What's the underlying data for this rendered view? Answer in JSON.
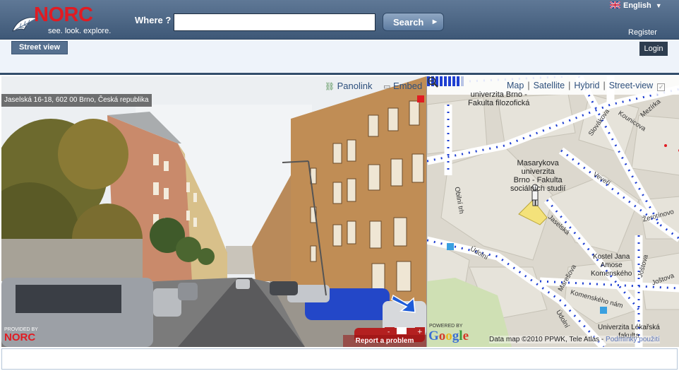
{
  "header": {
    "logo_word": "NORC",
    "slogan": "see. look. explore.",
    "where_label": "Where ?",
    "where_value": "",
    "search_label": "Search",
    "language": "English",
    "register_label": "Register"
  },
  "subbar": {
    "street_view_tab": "Street view",
    "login_label": "Login"
  },
  "panorama": {
    "panolink_label": "Panolink",
    "embed_label": "Embed",
    "address": "Jaselská 16-18, 602 00 Brno, Česká republika",
    "report_label": "Report a problem",
    "provided_by": "PROVIDED BY",
    "provided_logo": "NORC"
  },
  "map": {
    "types": [
      "Map",
      "Satellite",
      "Hybrid",
      "Street-view"
    ],
    "labels": {
      "fil_fac": "univerzita Brno -\nFakulta filozofická",
      "fss": "Masarykova\nuniverzita\nBrno - Fakulta\nsociálních studií",
      "kostel": "Kostel Jana\nAmose\nKomenského",
      "lekarska": "Univerzita Lékařská\nfakulta"
    },
    "streets": {
      "slovakova": "Slovákova",
      "kounicova": "Kounicova",
      "mezirka": "Mezírka",
      "veveri": "Veveří",
      "zerotinovo": "Žerotínovo",
      "obilni_trh": "Obilní trh",
      "jaselska": "Jaselská",
      "udolni": "Údolní",
      "joštova": "Joštova",
      "joštova2": "Joštova",
      "mareŝova": "Marešova",
      "komenskeho": "Komenského nám",
      "udolni2": "Údolní"
    },
    "powered_by": "POWERED BY",
    "google": "Google",
    "attribution": "Data map ©2010 PPWK, Tele Atlas -",
    "terms_link": "Podmínky použití"
  },
  "colors": {
    "header_top": "#5f7896",
    "header_bottom": "#3e5877",
    "accent_red": "#e11b22",
    "frame_border": "#334d6b",
    "street_view_blue": "#1f3fd1"
  }
}
